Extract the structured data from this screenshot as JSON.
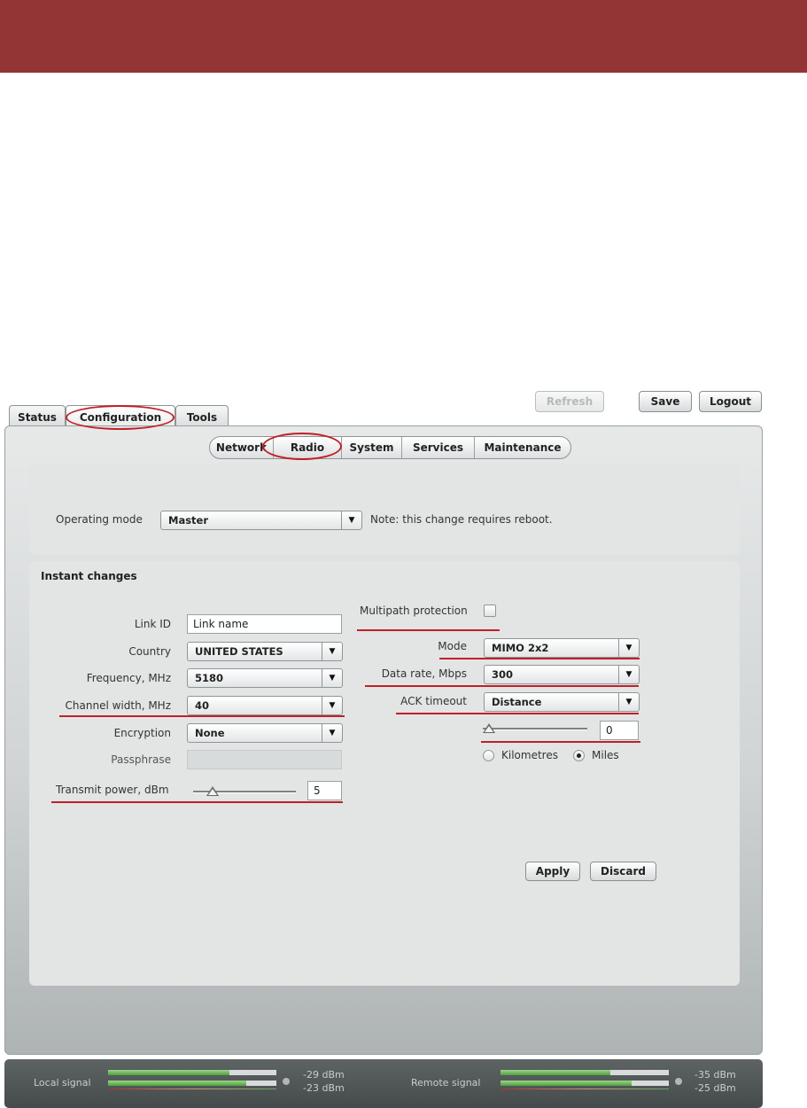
{
  "tabs": [
    {
      "label": "Status"
    },
    {
      "label": "Configuration"
    },
    {
      "label": "Tools"
    }
  ],
  "header_buttons": {
    "refresh": "Refresh",
    "save": "Save",
    "logout": "Logout"
  },
  "subtabs": [
    {
      "label": "Network"
    },
    {
      "label": "Radio"
    },
    {
      "label": "System"
    },
    {
      "label": "Services"
    },
    {
      "label": "Maintenance"
    }
  ],
  "operating": {
    "label": "Operating mode",
    "value": "Master",
    "note": "Note: this change requires reboot."
  },
  "instant": {
    "title": "Instant changes",
    "link_id": {
      "label": "Link ID",
      "value": "Link name"
    },
    "country": {
      "label": "Country",
      "value": "UNITED STATES"
    },
    "frequency": {
      "label": "Frequency, MHz",
      "value": "5180"
    },
    "channel_width": {
      "label": "Channel width, MHz",
      "value": "40"
    },
    "encryption": {
      "label": "Encryption",
      "value": "None"
    },
    "passphrase": {
      "label": "Passphrase",
      "value": ""
    },
    "transmit_power": {
      "label": "Transmit power, dBm",
      "value": "5"
    },
    "multipath": {
      "label": "Multipath protection",
      "checked": false
    },
    "mode": {
      "label": "Mode",
      "value": "MIMO 2x2"
    },
    "data_rate": {
      "label": "Data rate, Mbps",
      "value": "300"
    },
    "ack_timeout": {
      "label": "ACK timeout",
      "value": "Distance"
    },
    "distance": {
      "value": "0"
    },
    "units": {
      "km": "Kilometres",
      "miles": "Miles",
      "selected": "miles"
    }
  },
  "actions": {
    "apply": "Apply",
    "discard": "Discard"
  },
  "signal": {
    "local": {
      "label": "Local signal",
      "top_dbm": "-29 dBm",
      "bottom_dbm": "-23 dBm",
      "top_level": 0.72,
      "bottom_level": 0.82
    },
    "remote": {
      "label": "Remote signal",
      "top_dbm": "-35 dBm",
      "bottom_dbm": "-25 dBm",
      "top_level": 0.65,
      "bottom_level": 0.78
    }
  },
  "colors": {
    "banner": "#933534",
    "annotation": "#c0202a"
  }
}
